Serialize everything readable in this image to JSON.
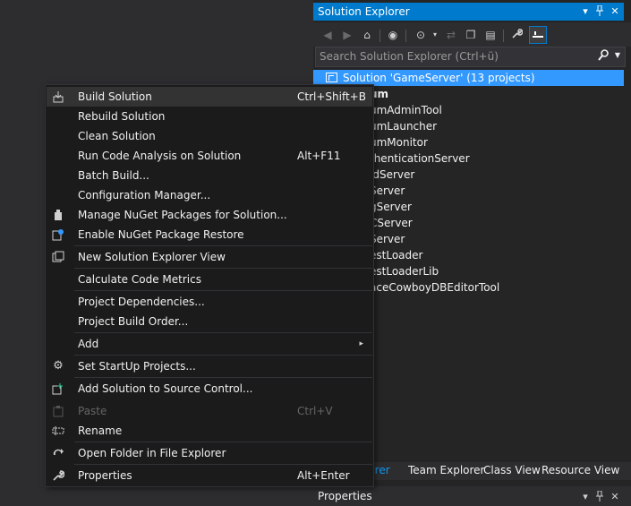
{
  "solution_explorer": {
    "title": "Solution Explorer",
    "title_buttons": {
      "dropdown": "▾",
      "pin": "📌",
      "close": "✕"
    },
    "search_placeholder": "Search Solution Explorer (Ctrl+ü)",
    "solution_label": "Solution 'GameServer' (13 projects)",
    "projects": [
      "um",
      "umAdminTool",
      "umLauncher",
      "umMonitor",
      "thenticationServer",
      "ldServer",
      "Server",
      "gServer",
      "CServer",
      "Server",
      "estLoader",
      "estLoaderLib",
      "aceCowboyDBEditorTool"
    ],
    "bottom_tabs": [
      "lorer",
      "Team Explorer",
      "Class View",
      "Resource View"
    ],
    "active_tab_index": 0
  },
  "properties_panel": {
    "title": "Properties",
    "buttons": {
      "dropdown": "▾",
      "pin": "📌",
      "close": "✕"
    }
  },
  "context_menu": {
    "items": [
      {
        "label": "Build Solution",
        "shortcut": "Ctrl+Shift+B",
        "icon": "build-icon"
      },
      {
        "label": "Rebuild Solution",
        "shortcut": ""
      },
      {
        "label": "Clean Solution",
        "shortcut": ""
      },
      {
        "label": "Run Code Analysis on Solution",
        "shortcut": "Alt+F11"
      },
      {
        "label": "Batch Build...",
        "shortcut": ""
      },
      {
        "label": "Configuration Manager...",
        "shortcut": ""
      },
      {
        "label": "Manage NuGet Packages for Solution...",
        "shortcut": "",
        "icon": "nuget-icon"
      },
      {
        "label": "Enable NuGet Package Restore",
        "shortcut": "",
        "icon": "nuget-restore-icon"
      },
      {
        "label": "New Solution Explorer View",
        "shortcut": "",
        "icon": "new-view-icon"
      },
      {
        "label": "Calculate Code Metrics",
        "shortcut": ""
      },
      {
        "label": "Project Dependencies...",
        "shortcut": ""
      },
      {
        "label": "Project Build Order...",
        "shortcut": ""
      },
      {
        "label": "Add",
        "shortcut": "",
        "submenu": "▸"
      },
      {
        "label": "Set StartUp Projects...",
        "shortcut": "",
        "icon": "gear-icon"
      },
      {
        "label": "Add Solution to Source Control...",
        "shortcut": "",
        "icon": "source-control-icon"
      },
      {
        "label": "Paste",
        "shortcut": "Ctrl+V",
        "icon": "paste-icon",
        "disabled": true
      },
      {
        "label": "Rename",
        "shortcut": "",
        "icon": "rename-icon"
      },
      {
        "label": "Open Folder in File Explorer",
        "shortcut": "",
        "icon": "open-folder-icon"
      },
      {
        "label": "Properties",
        "shortcut": "Alt+Enter",
        "icon": "wrench-icon"
      }
    ]
  }
}
